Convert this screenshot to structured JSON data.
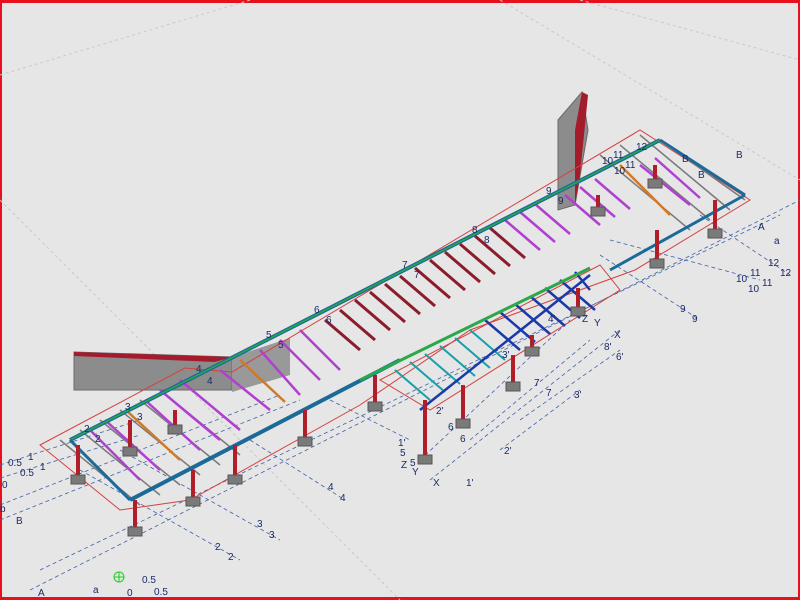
{
  "window": {
    "frame_color": "#e8101c",
    "background": "#e6e6e6"
  },
  "model": {
    "description_icon": "origin-axis-icon",
    "colors": {
      "purple_beam": "#b040d0",
      "orange_beam": "#d07a28",
      "dark_red_beam": "#8a1c2c",
      "blue_beam": "#1b3aa8",
      "cyan_beam": "#17a0a8",
      "green_beam": "#2aa84a",
      "column": "#b01e2a",
      "footing": "#7a7a7a",
      "deck_outline": "#d44040",
      "grid_line": "#4060a8",
      "ramp_wall": "#8c8c8c"
    }
  },
  "grid_labels": [
    {
      "id": "A-bottom",
      "text": "A"
    },
    {
      "id": "a-bottom",
      "text": "a"
    },
    {
      "id": "B-left",
      "text": "B"
    },
    {
      "id": "b-left",
      "text": "b"
    },
    {
      "id": "0-left",
      "text": "0"
    },
    {
      "id": "05-left",
      "text": "0.5"
    },
    {
      "id": "05-left-b",
      "text": "0.5"
    },
    {
      "id": "1-sup-a",
      "text": "1"
    },
    {
      "id": "1-sup-b",
      "text": "1"
    },
    {
      "id": "2a",
      "text": "2"
    },
    {
      "id": "2b",
      "text": "2"
    },
    {
      "id": "2c",
      "text": "2"
    },
    {
      "id": "2d",
      "text": "2"
    },
    {
      "id": "3a",
      "text": "3"
    },
    {
      "id": "3b",
      "text": "3"
    },
    {
      "id": "3c",
      "text": "3"
    },
    {
      "id": "3d",
      "text": "3"
    },
    {
      "id": "4a",
      "text": "4"
    },
    {
      "id": "4b",
      "text": "4"
    },
    {
      "id": "4c",
      "text": "4"
    },
    {
      "id": "4d",
      "text": "4"
    },
    {
      "id": "5a",
      "text": "5"
    },
    {
      "id": "5b",
      "text": "5"
    },
    {
      "id": "6a",
      "text": "6"
    },
    {
      "id": "6b",
      "text": "6"
    },
    {
      "id": "7a",
      "text": "7"
    },
    {
      "id": "7b",
      "text": "7"
    },
    {
      "id": "8a",
      "text": "8"
    },
    {
      "id": "8b",
      "text": "8"
    },
    {
      "id": "9a",
      "text": "9"
    },
    {
      "id": "9b",
      "text": "9"
    },
    {
      "id": "9c",
      "text": "9"
    },
    {
      "id": "9d",
      "text": "9"
    },
    {
      "id": "10a",
      "text": "10"
    },
    {
      "id": "10b",
      "text": "10"
    },
    {
      "id": "10c",
      "text": "10"
    },
    {
      "id": "10d",
      "text": "10"
    },
    {
      "id": "11a",
      "text": "11"
    },
    {
      "id": "11b",
      "text": "11"
    },
    {
      "id": "11c",
      "text": "11"
    },
    {
      "id": "11d",
      "text": "11"
    },
    {
      "id": "12a",
      "text": "12"
    },
    {
      "id": "12b",
      "text": "12"
    },
    {
      "id": "12c",
      "text": "12"
    },
    {
      "id": "Ba",
      "text": "B"
    },
    {
      "id": "Bb",
      "text": "B"
    },
    {
      "id": "Bc",
      "text": "B"
    },
    {
      "id": "A-right",
      "text": "A"
    },
    {
      "id": "a-right",
      "text": "a"
    },
    {
      "id": "Z-right",
      "text": "Z"
    },
    {
      "id": "Y-right",
      "text": "Y"
    },
    {
      "id": "X-right",
      "text": "X"
    },
    {
      "id": "8p",
      "text": "8'"
    },
    {
      "id": "6p-right",
      "text": "6'"
    },
    {
      "id": "4p",
      "text": "4'"
    },
    {
      "id": "3p",
      "text": "3'"
    },
    {
      "id": "3p-b",
      "text": "3'"
    },
    {
      "id": "7p",
      "text": "7"
    },
    {
      "id": "7p-b",
      "text": "7"
    },
    {
      "id": "2p",
      "text": "2'"
    },
    {
      "id": "2p-b",
      "text": "2'"
    },
    {
      "id": "6p",
      "text": "6"
    },
    {
      "id": "6p-b",
      "text": "6"
    },
    {
      "id": "1p",
      "text": "1'"
    },
    {
      "id": "1p-b",
      "text": "1'"
    },
    {
      "id": "5p",
      "text": "5"
    },
    {
      "id": "5p-b",
      "text": "5"
    },
    {
      "id": "Z-left",
      "text": "Z"
    },
    {
      "id": "Y-left",
      "text": "Y"
    },
    {
      "id": "X-left",
      "text": "X"
    },
    {
      "id": "0-bottom",
      "text": "0"
    },
    {
      "id": "05-bottom-a",
      "text": "0.5"
    },
    {
      "id": "05-bottom-b",
      "text": "0.5"
    }
  ]
}
